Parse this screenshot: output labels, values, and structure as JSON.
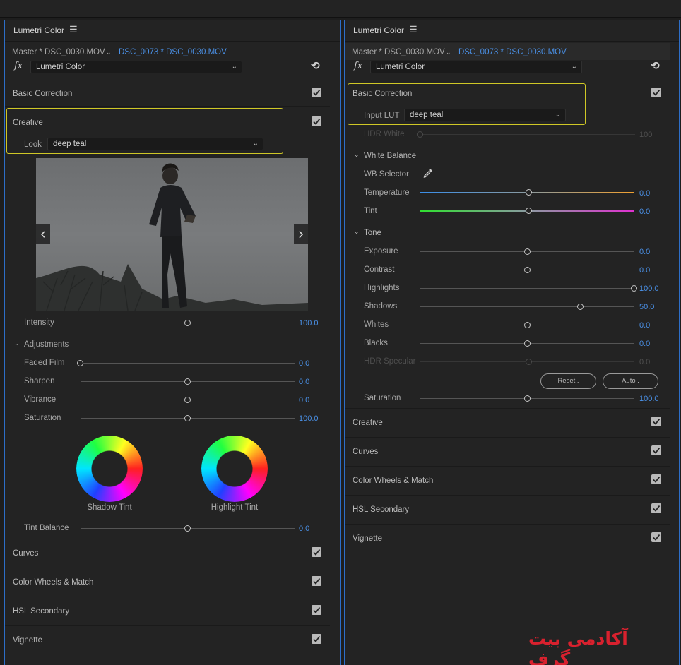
{
  "left_panel": {
    "title": "Lumetri Color",
    "menu_icon": "hamburger-icon",
    "master_clip": "Master * DSC_0030.MOV",
    "sequence_clip": "DSC_0073 * DSC_0030.MOV",
    "effect": "Lumetri Color",
    "basic_correction": "Basic Correction",
    "creative": {
      "title": "Creative",
      "look_label": "Look",
      "look_value": "deep teal",
      "intensity_label": "Intensity",
      "intensity_value": "100.0",
      "intensity_level": 0.5,
      "adjustments_title": "Adjustments",
      "sliders": [
        {
          "label": "Faded Film",
          "value": "0.0",
          "level": 0
        },
        {
          "label": "Sharpen",
          "value": "0.0",
          "level": 0.5
        },
        {
          "label": "Vibrance",
          "value": "0.0",
          "level": 0.5
        },
        {
          "label": "Saturation",
          "value": "100.0",
          "level": 0.5
        }
      ],
      "shadow_tint_label": "Shadow Tint",
      "highlight_tint_label": "Highlight Tint",
      "tint_balance_label": "Tint Balance",
      "tint_balance_value": "0.0",
      "tint_balance_level": 0.5
    },
    "sections": [
      {
        "label": "Curves"
      },
      {
        "label": "Color Wheels & Match"
      },
      {
        "label": "HSL Secondary"
      },
      {
        "label": "Vignette"
      }
    ]
  },
  "right_panel": {
    "title": "Lumetri Color",
    "master_clip": "Master * DSC_0030.MOV",
    "sequence_clip": "DSC_0073 * DSC_0030.MOV",
    "effect": "Lumetri Color",
    "basic_correction": {
      "title": "Basic Correction",
      "input_lut_label": "Input LUT",
      "input_lut_value": "deep teal",
      "hdr_white_label": "HDR White",
      "hdr_white_value": "100",
      "white_balance_title": "White Balance",
      "wb_selector_label": "WB Selector",
      "temperature_label": "Temperature",
      "temperature_value": "0.0",
      "tint_label": "Tint",
      "tint_value": "0.0",
      "tone_title": "Tone",
      "tone_sliders": [
        {
          "label": "Exposure",
          "value": "0.0",
          "level": 0.5
        },
        {
          "label": "Contrast",
          "value": "0.0",
          "level": 0.5
        },
        {
          "label": "Highlights",
          "value": "100.0",
          "level": 1.0
        },
        {
          "label": "Shadows",
          "value": "50.0",
          "level": 0.75
        },
        {
          "label": "Whites",
          "value": "0.0",
          "level": 0.5
        },
        {
          "label": "Blacks",
          "value": "0.0",
          "level": 0.5
        }
      ],
      "hdr_specular_label": "HDR Specular",
      "hdr_specular_value": "0.0",
      "reset_label": "Reset",
      "auto_label": "Auto",
      "saturation_label": "Saturation",
      "saturation_value": "100.0",
      "saturation_level": 0.5
    },
    "sections": [
      {
        "label": "Creative"
      },
      {
        "label": "Curves"
      },
      {
        "label": "Color Wheels & Match"
      },
      {
        "label": "HSL Secondary"
      },
      {
        "label": "Vignette"
      }
    ]
  },
  "watermark": "آکادمی بیت گرف",
  "colors": {
    "accent_blue": "#4a90e6",
    "highlight_box": "#cfc726",
    "watermark_red": "#d8212e",
    "panel_border": "#2d6ec8"
  }
}
